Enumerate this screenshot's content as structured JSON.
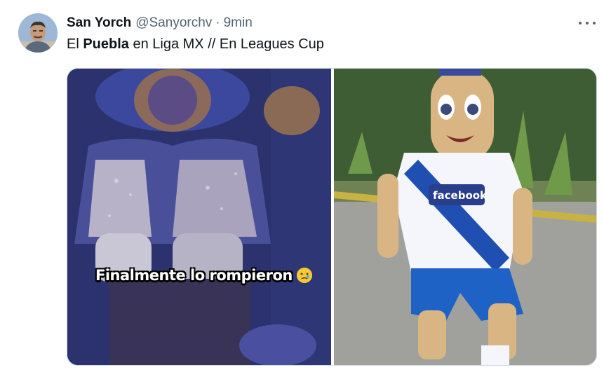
{
  "tweet": {
    "author_name": "San Yorch",
    "author_handle": "@Sanyorchv",
    "separator": "·",
    "time": "9min",
    "text_before": "El ",
    "text_bold": "Puebla",
    "text_after": " en Liga MX // En Leagues Cup"
  },
  "media": {
    "left_caption": "Finalmente lo rompieron",
    "caption_emoji": "crying-face-emoji",
    "mascot_jersey_text": "facebook"
  },
  "icons": {
    "more": "more-options-icon",
    "avatar": "avatar"
  },
  "colors": {
    "name": "#0f1419",
    "secondary": "#536471",
    "border": "#cfd9de"
  }
}
